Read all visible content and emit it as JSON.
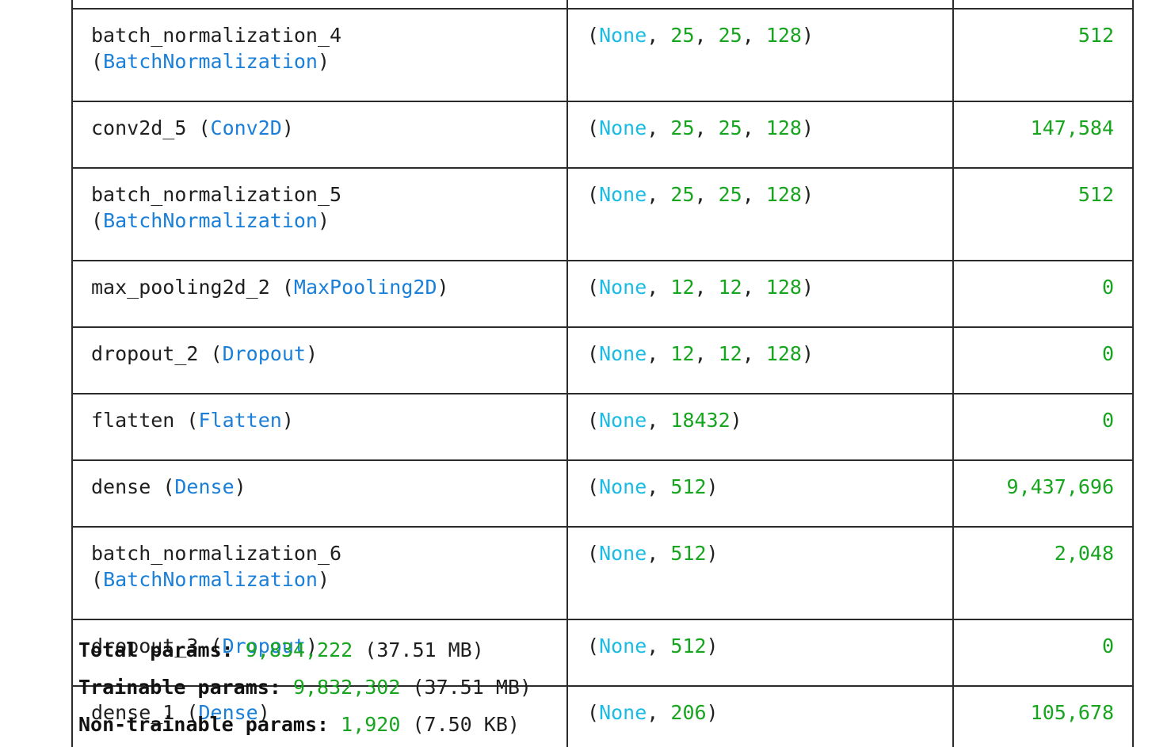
{
  "layers": [
    {
      "name": "batch_normalization_4",
      "type": "BatchNormalization",
      "shape": [
        "None",
        "25",
        "25",
        "128"
      ],
      "params": "512",
      "wrap": true
    },
    {
      "name": "conv2d_5",
      "type": "Conv2D",
      "shape": [
        "None",
        "25",
        "25",
        "128"
      ],
      "params": "147,584",
      "wrap": false
    },
    {
      "name": "batch_normalization_5",
      "type": "BatchNormalization",
      "shape": [
        "None",
        "25",
        "25",
        "128"
      ],
      "params": "512",
      "wrap": true
    },
    {
      "name": "max_pooling2d_2",
      "type": "MaxPooling2D",
      "shape": [
        "None",
        "12",
        "12",
        "128"
      ],
      "params": "0",
      "wrap": false
    },
    {
      "name": "dropout_2",
      "type": "Dropout",
      "shape": [
        "None",
        "12",
        "12",
        "128"
      ],
      "params": "0",
      "wrap": false
    },
    {
      "name": "flatten",
      "type": "Flatten",
      "shape": [
        "None",
        "18432"
      ],
      "params": "0",
      "wrap": false
    },
    {
      "name": "dense",
      "type": "Dense",
      "shape": [
        "None",
        "512"
      ],
      "params": "9,437,696",
      "wrap": false
    },
    {
      "name": "batch_normalization_6",
      "type": "BatchNormalization",
      "shape": [
        "None",
        "512"
      ],
      "params": "2,048",
      "wrap": true
    },
    {
      "name": "dropout_3",
      "type": "Dropout",
      "shape": [
        "None",
        "512"
      ],
      "params": "0",
      "wrap": false
    },
    {
      "name": "dense_1",
      "type": "Dense",
      "shape": [
        "None",
        "206"
      ],
      "params": "105,678",
      "wrap": false
    }
  ],
  "totals": {
    "total_label": "Total params:",
    "total_value": "9,834,222",
    "total_mem": "(37.51 MB)",
    "trainable_label": "Trainable params:",
    "trainable_value": "9,832,302",
    "trainable_mem": "(37.51 MB)",
    "non_trainable_label": "Non-trainable params:",
    "non_trainable_value": "1,920",
    "non_trainable_mem": "(7.50 KB)"
  },
  "colors": {
    "class_name": "#1a7fd8",
    "none_keyword": "#1cbbe3",
    "number": "#17a51f",
    "border": "#2b2b2b"
  }
}
